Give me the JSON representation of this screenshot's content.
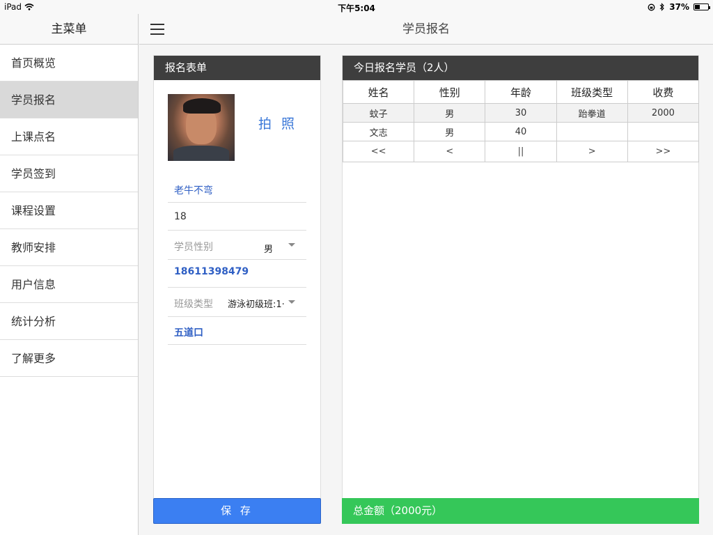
{
  "status": {
    "device": "iPad",
    "time": "下午5:04",
    "battery": "37%",
    "battery_level": 0.37
  },
  "sidebar": {
    "title": "主菜单",
    "items": [
      {
        "label": "首页概览"
      },
      {
        "label": "学员报名"
      },
      {
        "label": "上课点名"
      },
      {
        "label": "学员签到"
      },
      {
        "label": "课程设置"
      },
      {
        "label": "教师安排"
      },
      {
        "label": "用户信息"
      },
      {
        "label": "统计分析"
      },
      {
        "label": "了解更多"
      }
    ]
  },
  "header": {
    "title": "学员报名"
  },
  "form": {
    "title": "报名表单",
    "photo_label": "拍 照",
    "name": "老牛不弯",
    "age": "18",
    "gender_label": "学员性别",
    "gender_value": "男",
    "phone": "18611398479",
    "class_label": "班级类型",
    "class_value": "游泳初级班:1·",
    "address": "五道口",
    "save_label": "保 存"
  },
  "list": {
    "title": "今日报名学员（2人）",
    "columns": [
      "姓名",
      "性别",
      "年龄",
      "班级类型",
      "收费"
    ],
    "rows": [
      [
        "蚊子",
        "男",
        "30",
        "跆拳道",
        "2000"
      ],
      [
        "文志",
        "男",
        "40",
        "",
        ""
      ]
    ],
    "pager": [
      "<<",
      "<",
      "||",
      ">",
      ">>"
    ],
    "total": "总金额（2000元）"
  }
}
